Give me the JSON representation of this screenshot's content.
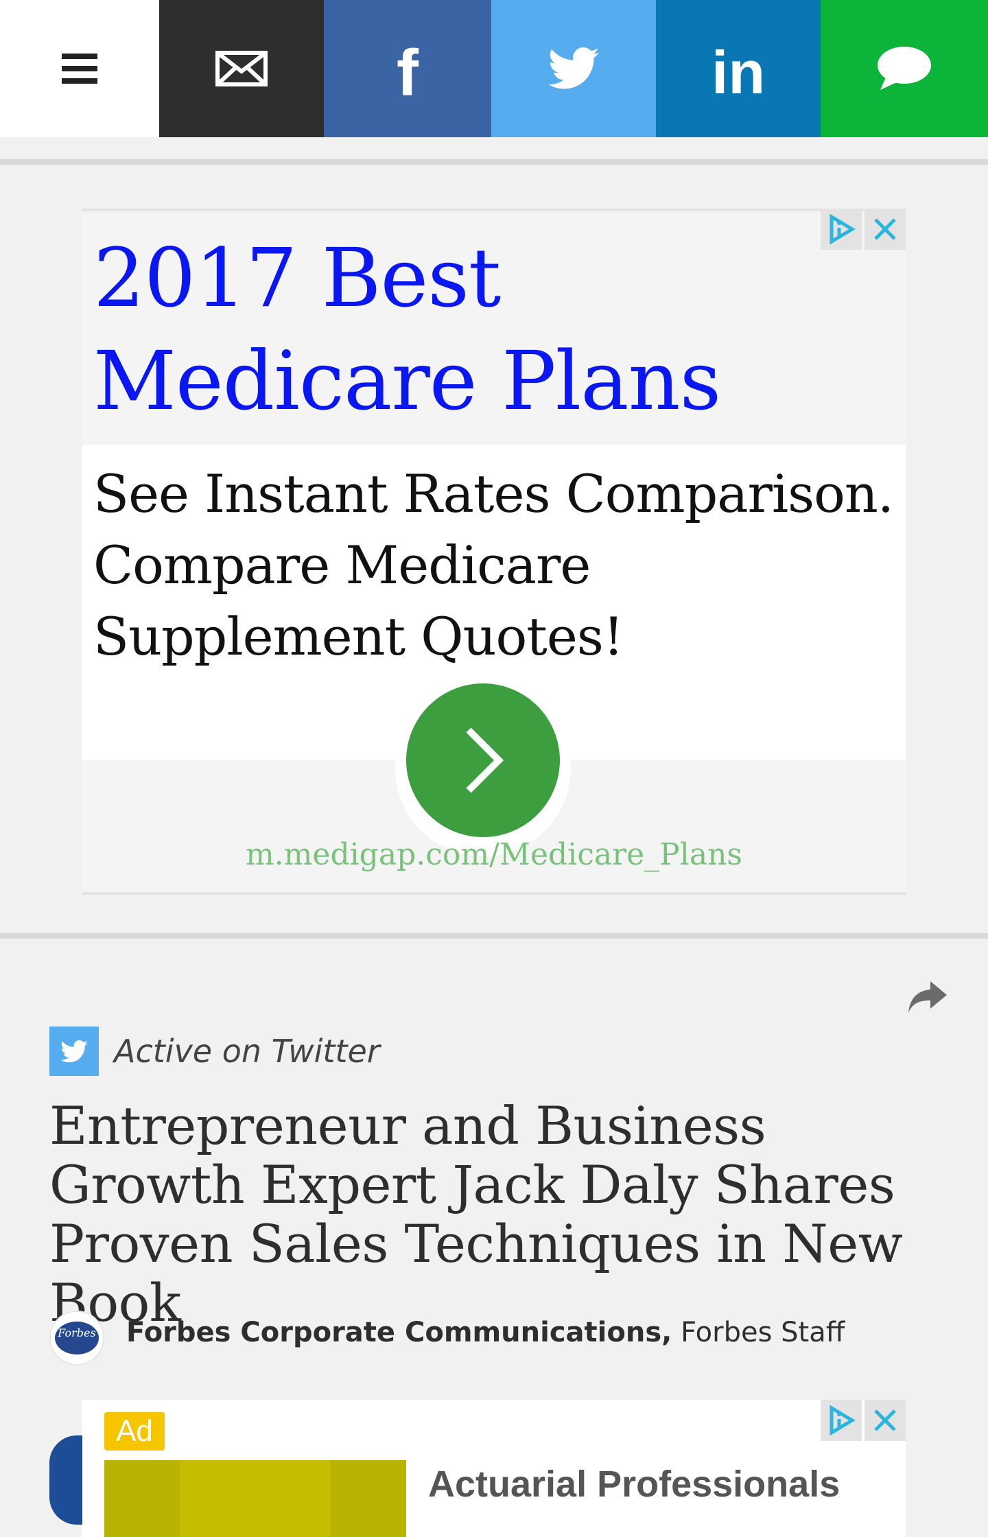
{
  "share_bar": {
    "items": [
      {
        "name": "menu",
        "icon": "hamburger-icon",
        "color": "#ffffff"
      },
      {
        "name": "email",
        "icon": "envelope-icon",
        "color": "#2e2e2e"
      },
      {
        "name": "facebook",
        "icon": "facebook-icon",
        "color": "#3b64a4"
      },
      {
        "name": "twitter",
        "icon": "twitter-icon",
        "color": "#55acee"
      },
      {
        "name": "linkedin",
        "icon": "linkedin-icon",
        "color": "#0a77b5"
      },
      {
        "name": "sms",
        "icon": "chat-bubble-icon",
        "color": "#0cb43a"
      }
    ],
    "facebook_glyph": "f",
    "linkedin_glyph": "in"
  },
  "ad1": {
    "headline": "2017 Best Medicare Plans",
    "body": "See Instant Rates Comparison. Compare Medicare Supplement Quotes!",
    "url": "m.medigap.com/Medicare_Plans",
    "headline_color": "#0b17f0",
    "button_color": "#3d9e3f",
    "url_color": "#79c27b"
  },
  "article": {
    "badge_label": "Active on Twitter",
    "title": "Entrepreneur and Business Growth Expert Jack Daly Shares Proven Sales Techniques in New Book",
    "author_name": "Forbes Corporate Communications,",
    "author_role": "Forbes Staff",
    "avatar_text": "Forbes"
  },
  "ad2": {
    "badge": "Ad",
    "title": "Actuarial Professionals",
    "badge_color": "#f5c500"
  }
}
